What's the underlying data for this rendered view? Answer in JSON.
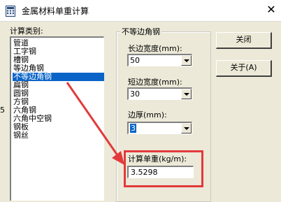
{
  "window": {
    "title": "金属材料单重计算",
    "close_glyph": "✕"
  },
  "category": {
    "label": "计算类别:",
    "items": [
      "管道",
      "工字钢",
      "槽钢",
      "等边角钢",
      "不等边角钢",
      "扁钢",
      "圆钢",
      "方钢",
      "六角钢",
      "六角中空钢",
      "钢板",
      "钢丝"
    ],
    "selected_index": 4
  },
  "group": {
    "title": "不等边角钢",
    "long_side": {
      "label": "长边宽度(mm):",
      "value": "50"
    },
    "short_side": {
      "label": "短边宽度(mm):",
      "value": "30"
    },
    "thickness": {
      "label": "边厚(mm):",
      "value": "3"
    },
    "result": {
      "label": "计算单重(kg/m):",
      "value": "3.5298"
    }
  },
  "buttons": {
    "close": "关闭",
    "about": "关于(A)"
  },
  "edge_glyph": "5",
  "colors": {
    "highlight": "#0a64c8",
    "annotation_red": "#e23a3a"
  }
}
